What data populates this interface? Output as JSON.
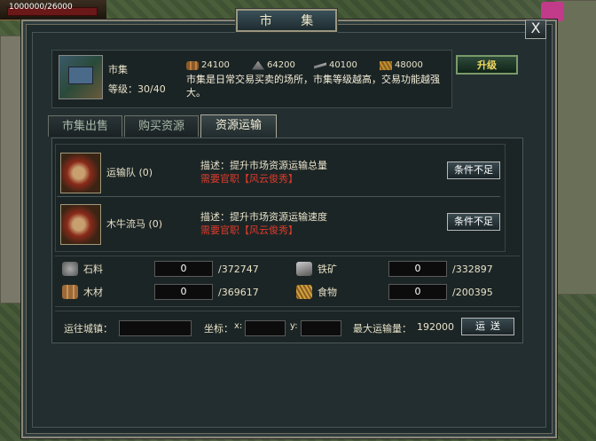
{
  "hud": {
    "hp_text": "1000000/26000"
  },
  "window": {
    "title": "市 集",
    "close_label": "X"
  },
  "market": {
    "name": "市集",
    "level_text": "等级：30/40",
    "resources": [
      {
        "icon": "wood-icon",
        "value": "24100"
      },
      {
        "icon": "stone-icon",
        "value": "64200"
      },
      {
        "icon": "iron-icon",
        "value": "40100"
      },
      {
        "icon": "food-icon",
        "value": "48000"
      }
    ],
    "description": "市集是日常交易买卖的场所，市集等级越高，交易功能越强大。",
    "upgrade_label": "升级"
  },
  "tabs": [
    {
      "label": "市集出售",
      "active": false
    },
    {
      "label": "购买资源",
      "active": false
    },
    {
      "label": "资源运输",
      "active": true
    }
  ],
  "units": [
    {
      "name": "运输队 (0)",
      "desc": "描述：提升市场资源运输总量",
      "req": "需要官职【风云俊秀】",
      "button": "条件不足"
    },
    {
      "name": "木牛流马 (0)",
      "desc": "描述：提升市场资源运输速度",
      "req": "需要官职【风云俊秀】",
      "button": "条件不足"
    }
  ],
  "stock": [
    {
      "icon": "stone-icon",
      "label": "石料",
      "value": "0",
      "max": "/372747"
    },
    {
      "icon": "iron-icon",
      "label": "铁矿",
      "value": "0",
      "max": "/332897"
    },
    {
      "icon": "wood-icon",
      "label": "木材",
      "value": "0",
      "max": "/369617"
    },
    {
      "icon": "food-icon",
      "label": "食物",
      "value": "0",
      "max": "/200395"
    }
  ],
  "transport": {
    "city_label": "运往城镇：",
    "city_value": "",
    "coord_label": "坐标：",
    "x_label": "x:",
    "x_value": "",
    "y_label": "y:",
    "y_value": "",
    "max_label": "最大运输量：",
    "max_value": "192000",
    "send_label": "运送"
  },
  "colors": {
    "panel_bg": "#1f2b2d",
    "warning": "#e03a2a",
    "upgrade_text": "#f0d860"
  }
}
